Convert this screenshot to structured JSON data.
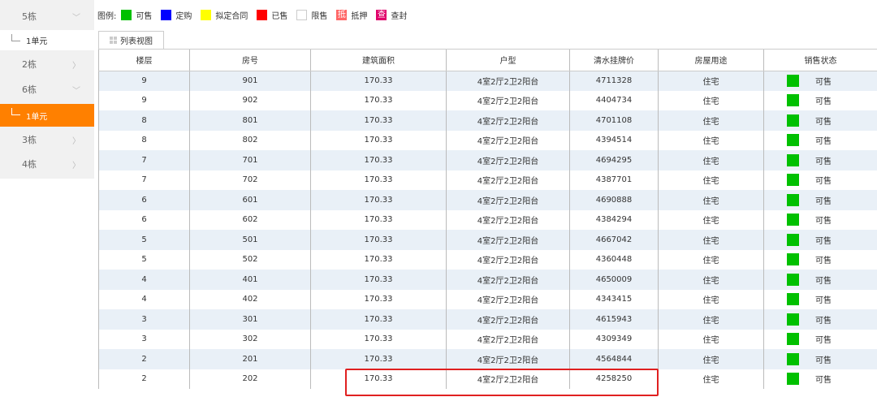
{
  "sidebar": {
    "items": [
      {
        "label": "5栋",
        "arrow": "﹀"
      },
      {
        "label": "1单元"
      },
      {
        "label": "2栋",
        "arrow": "〉"
      },
      {
        "label": "6栋",
        "arrow": "﹀"
      },
      {
        "label": "1单元"
      },
      {
        "label": "3栋",
        "arrow": "〉"
      },
      {
        "label": "4栋",
        "arrow": "〉"
      }
    ]
  },
  "legend": {
    "title": "图例:",
    "items": [
      {
        "label": "可售",
        "color": "#00c000"
      },
      {
        "label": "定购",
        "color": "#0000ff"
      },
      {
        "label": "拟定合同",
        "color": "#ffff00"
      },
      {
        "label": "已售",
        "color": "#ff0000"
      },
      {
        "label": "限售",
        "color": "#ffffff"
      },
      {
        "label": "抵押",
        "glyph": "抵",
        "color": "#ff6666"
      },
      {
        "label": "查封",
        "glyph": "查",
        "color": "#e0006a"
      }
    ]
  },
  "tab": {
    "label": "列表视图"
  },
  "table": {
    "headers": [
      "楼层",
      "房号",
      "建筑面积",
      "户型",
      "清水挂牌价",
      "房屋用途",
      "销售状态"
    ],
    "status_color": "#00c000",
    "rows": [
      [
        "9",
        "901",
        "170.33",
        "4室2厅2卫2阳台",
        "4711328",
        "住宅",
        "可售"
      ],
      [
        "9",
        "902",
        "170.33",
        "4室2厅2卫2阳台",
        "4404734",
        "住宅",
        "可售"
      ],
      [
        "8",
        "801",
        "170.33",
        "4室2厅2卫2阳台",
        "4701108",
        "住宅",
        "可售"
      ],
      [
        "8",
        "802",
        "170.33",
        "4室2厅2卫2阳台",
        "4394514",
        "住宅",
        "可售"
      ],
      [
        "7",
        "701",
        "170.33",
        "4室2厅2卫2阳台",
        "4694295",
        "住宅",
        "可售"
      ],
      [
        "7",
        "702",
        "170.33",
        "4室2厅2卫2阳台",
        "4387701",
        "住宅",
        "可售"
      ],
      [
        "6",
        "601",
        "170.33",
        "4室2厅2卫2阳台",
        "4690888",
        "住宅",
        "可售"
      ],
      [
        "6",
        "602",
        "170.33",
        "4室2厅2卫2阳台",
        "4384294",
        "住宅",
        "可售"
      ],
      [
        "5",
        "501",
        "170.33",
        "4室2厅2卫2阳台",
        "4667042",
        "住宅",
        "可售"
      ],
      [
        "5",
        "502",
        "170.33",
        "4室2厅2卫2阳台",
        "4360448",
        "住宅",
        "可售"
      ],
      [
        "4",
        "401",
        "170.33",
        "4室2厅2卫2阳台",
        "4650009",
        "住宅",
        "可售"
      ],
      [
        "4",
        "402",
        "170.33",
        "4室2厅2卫2阳台",
        "4343415",
        "住宅",
        "可售"
      ],
      [
        "3",
        "301",
        "170.33",
        "4室2厅2卫2阳台",
        "4615943",
        "住宅",
        "可售"
      ],
      [
        "3",
        "302",
        "170.33",
        "4室2厅2卫2阳台",
        "4309349",
        "住宅",
        "可售"
      ],
      [
        "2",
        "201",
        "170.33",
        "4室2厅2卫2阳台",
        "4564844",
        "住宅",
        "可售"
      ],
      [
        "2",
        "202",
        "170.33",
        "4室2厅2卫2阳台",
        "4258250",
        "住宅",
        "可售"
      ]
    ]
  }
}
